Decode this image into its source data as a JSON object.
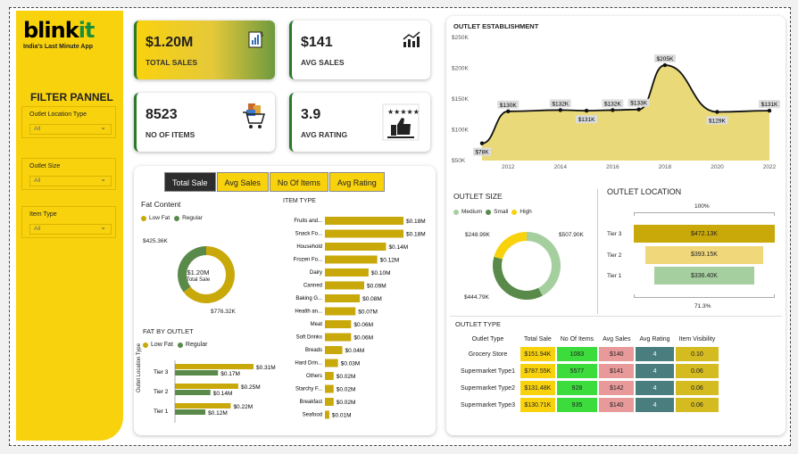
{
  "brand": {
    "name_a": "blink",
    "name_b": "it",
    "tagline": "India's Last Minute App"
  },
  "filters": {
    "title": "FILTER PANNEL",
    "items": [
      {
        "label": "Outlet Location Type",
        "value": "All"
      },
      {
        "label": "Outlet Size",
        "value": "All"
      },
      {
        "label": "Item Type",
        "value": "All"
      }
    ]
  },
  "kpis": [
    {
      "value": "$1.20M",
      "label": "TOTAL SALES",
      "icon": "sales-receipt-icon"
    },
    {
      "value": "$141",
      "label": "AVG SALES",
      "icon": "trend-up-icon"
    },
    {
      "value": "8523",
      "label": "NO OF ITEMS",
      "icon": "shopping-cart-icon"
    },
    {
      "value": "3.9",
      "label": "AVG RATING",
      "icon": "thumbs-up-rating-icon"
    }
  ],
  "tabs": [
    "Total Sale",
    "Avg Sales",
    "No Of Items",
    "Avg Rating"
  ],
  "colors": {
    "yellow": "#f9d20e",
    "green": "#5a8a4a",
    "olive": "#c9a80a",
    "light_green": "#a6cfa0"
  },
  "chart_data": [
    {
      "type": "pie",
      "title": "Fat Content",
      "legend": [
        "Low Fat",
        "Regular"
      ],
      "values": [
        776.32,
        425.36
      ],
      "labels": [
        "$776.32K",
        "$425.36K"
      ],
      "center_value": "$1.20M",
      "center_label": "Total Sale"
    },
    {
      "type": "bar",
      "title": "FAT BY OUTLET",
      "legend": [
        "Low Fat",
        "Regular"
      ],
      "ylabel": "Outlet Location Type",
      "categories": [
        "Tier 3",
        "Tier 2",
        "Tier 1"
      ],
      "series": [
        {
          "name": "Low Fat",
          "values": [
            0.31,
            0.25,
            0.22
          ],
          "labels": [
            "$0.31M",
            "$0.25M",
            "$0.22M"
          ]
        },
        {
          "name": "Regular",
          "values": [
            0.17,
            0.14,
            0.12
          ],
          "labels": [
            "$0.17M",
            "$0.14M",
            "$0.12M"
          ]
        }
      ]
    },
    {
      "type": "bar",
      "title": "ITEM TYPE",
      "categories": [
        "Fruits and...",
        "Snack Fo...",
        "Household",
        "Frozen Fo...",
        "Dairy",
        "Canned",
        "Baking G...",
        "Health an...",
        "Meat",
        "Soft Drinks",
        "Breads",
        "Hard Drin...",
        "Others",
        "Starchy F...",
        "Breakfast",
        "Seafood"
      ],
      "values": [
        0.18,
        0.18,
        0.14,
        0.12,
        0.1,
        0.09,
        0.08,
        0.07,
        0.06,
        0.06,
        0.04,
        0.03,
        0.02,
        0.02,
        0.02,
        0.01
      ],
      "labels": [
        "$0.18M",
        "$0.18M",
        "$0.14M",
        "$0.12M",
        "$0.10M",
        "$0.09M",
        "$0.08M",
        "$0.07M",
        "$0.06M",
        "$0.06M",
        "$0.04M",
        "$0.03M",
        "$0.02M",
        "$0.02M",
        "$0.02M",
        "$0.01M"
      ]
    },
    {
      "type": "area",
      "title": "OUTLET ESTABLISHMENT",
      "x": [
        2011,
        2012,
        2014,
        2015,
        2016,
        2017,
        2018,
        2020,
        2022
      ],
      "x_ticks": [
        "2012",
        "2014",
        "2016",
        "2018",
        "2020",
        "2022"
      ],
      "values": [
        78,
        130,
        132,
        131,
        132,
        133,
        205,
        129,
        131
      ],
      "labels": [
        "$78K",
        "$130K",
        "$132K",
        "$131K",
        "$132K",
        "$133K",
        "$205K",
        "$129K",
        "$131K"
      ],
      "y_ticks": [
        "$250K",
        "$200K",
        "$150K",
        "$100K",
        "$50K"
      ],
      "ylim": [
        50,
        250
      ],
      "xlim": [
        2011,
        2022
      ]
    },
    {
      "type": "pie",
      "title": "OUTLET SIZE",
      "legend": [
        "Medium",
        "Small",
        "High"
      ],
      "values": [
        507.9,
        444.79,
        248.99
      ],
      "labels": [
        "$507.90K",
        "$444.79K",
        "$248.99K"
      ]
    },
    {
      "type": "bar",
      "title": "OUTLET LOCATION",
      "subtitle_top": "100%",
      "subtitle_bottom": "71.3%",
      "categories": [
        "Tier 3",
        "Tier 2",
        "Tier 1"
      ],
      "values": [
        472.13,
        393.15,
        336.4
      ],
      "labels": [
        "$472.13K",
        "$393.15K",
        "$336.40K"
      ]
    },
    {
      "type": "table",
      "title": "OUTLET TYPE",
      "columns": [
        "Outlet Type",
        "Total Sale",
        "No Of Items",
        "Avg Sales",
        "Avg Rating",
        "Item Visibility"
      ],
      "rows": [
        [
          "Grocery Store",
          "$151.94K",
          "1083",
          "$140",
          "4",
          "0.10"
        ],
        [
          "Supermarket Type1",
          "$787.55K",
          "5577",
          "$141",
          "4",
          "0.06"
        ],
        [
          "Supermarket Type2",
          "$131.48K",
          "928",
          "$142",
          "4",
          "0.06"
        ],
        [
          "Supermarket Type3",
          "$130.71K",
          "935",
          "$140",
          "4",
          "0.06"
        ]
      ]
    }
  ]
}
